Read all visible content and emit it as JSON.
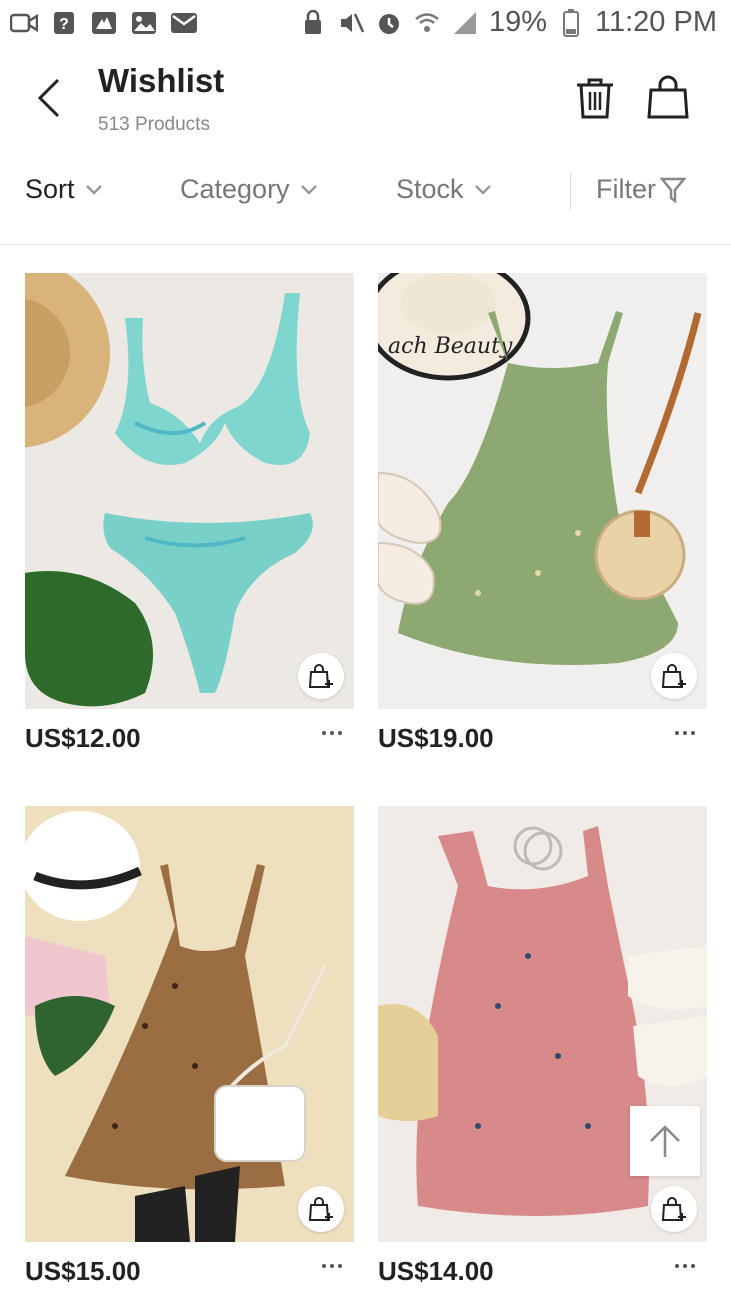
{
  "status_bar": {
    "battery": "19%",
    "time": "11:20 PM",
    "left_icons": [
      "video-camera-icon",
      "help-icon",
      "app-icon",
      "image-icon",
      "mail-icon"
    ],
    "right_icons": [
      "lock-icon",
      "mute-icon",
      "alarm-icon",
      "wifi-icon",
      "signal-icon",
      "battery-icon"
    ]
  },
  "header": {
    "title": "Wishlist",
    "subtitle": "513 Products"
  },
  "filters": {
    "sort": "Sort",
    "category": "Category",
    "stock": "Stock",
    "filter": "Filter"
  },
  "products": [
    {
      "price": "US$12.00",
      "image": "mint tie-dye bikini set"
    },
    {
      "price": "US$19.00",
      "image": "green floral sundress"
    },
    {
      "price": "US$15.00",
      "image": "leopard tiered dress"
    },
    {
      "price": "US$14.00",
      "image": "pink floral dress"
    }
  ],
  "colors": {
    "text": "#222222",
    "muted": "#777777",
    "divider": "#e5e5e5"
  }
}
